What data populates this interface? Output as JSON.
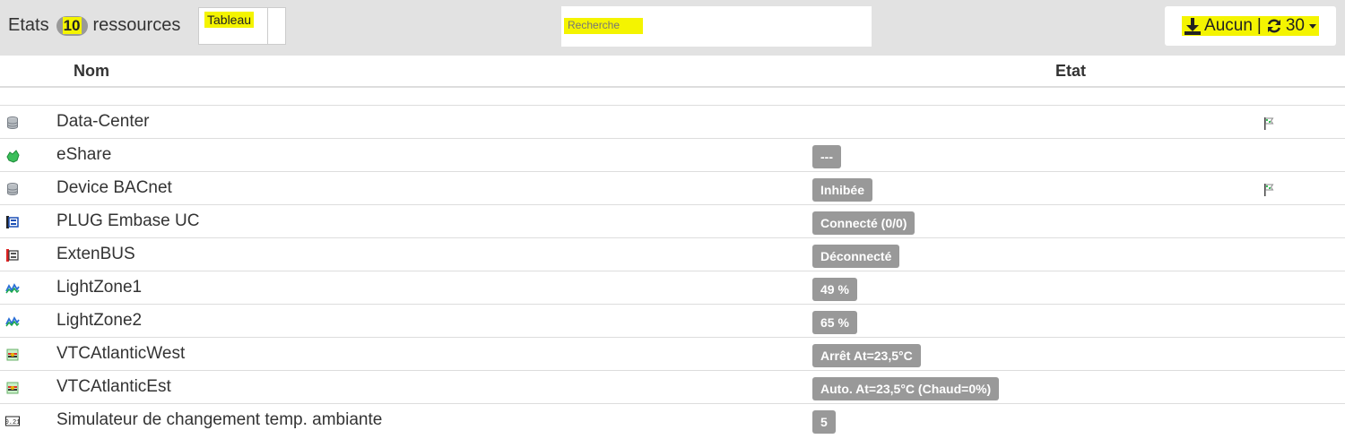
{
  "header": {
    "title_prefix": "Etats",
    "count": "10",
    "title_suffix": "ressources",
    "view_select": "Tableau",
    "search_placeholder": "Recherche",
    "export_label": "Aucun",
    "separator": "|",
    "refresh_interval": "30"
  },
  "table": {
    "columns": {
      "nom": "Nom",
      "etat": "Etat"
    },
    "rows": [
      {
        "name": "Data-Center",
        "state": "",
        "icon": "database-icon",
        "flag": true
      },
      {
        "name": "eShare",
        "state": "---",
        "icon": "share-icon",
        "flag": false
      },
      {
        "name": "Device BACnet",
        "state": "Inhibée",
        "icon": "database-icon",
        "flag": true
      },
      {
        "name": "PLUG Embase UC",
        "state": "Connecté (0/0)",
        "icon": "plug-icon",
        "flag": false
      },
      {
        "name": "ExtenBUS",
        "state": "Déconnecté",
        "icon": "bus-icon",
        "flag": false
      },
      {
        "name": "LightZone1",
        "state": "49 %",
        "icon": "light-zone-icon",
        "flag": false
      },
      {
        "name": "LightZone2",
        "state": "65 %",
        "icon": "light-zone-icon",
        "flag": false
      },
      {
        "name": "VTCAtlanticWest",
        "state": "Arrêt At=23,5°C",
        "icon": "hvac-icon",
        "flag": false
      },
      {
        "name": "VTCAtlanticEst",
        "state": "Auto. At=23,5°C (Chaud=0%)",
        "icon": "hvac-icon",
        "flag": false
      },
      {
        "name": "Simulateur de changement temp. ambiante",
        "state": "5",
        "icon": "counter-icon",
        "flag": false
      }
    ]
  },
  "colors": {
    "highlight": "#f4f400",
    "badge": "#999999",
    "topbar": "#e2e2e2"
  }
}
